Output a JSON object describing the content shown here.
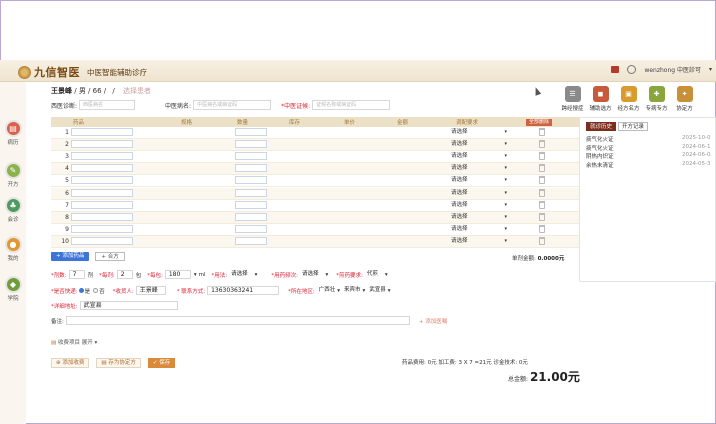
{
  "app": {
    "brand": "九信智医",
    "subtitle": "中医智能辅助诊疗",
    "user": "wenzhong 中医診可",
    "user_chevron": "▾"
  },
  "sidebar": [
    {
      "label": "病历",
      "icon": "medical-record-icon",
      "glyph": "▤",
      "color": "#d9604a"
    },
    {
      "label": "开方",
      "icon": "prescription-icon",
      "glyph": "✎",
      "color": "#8bb24b"
    },
    {
      "label": "会诊",
      "icon": "consultation-icon",
      "glyph": "♣",
      "color": "#4f9a5c"
    },
    {
      "label": "我的",
      "icon": "user-icon",
      "glyph": "●",
      "color": "#e3982f"
    },
    {
      "label": "学院",
      "icon": "academy-icon",
      "glyph": "◆",
      "color": "#6f9d3a"
    }
  ],
  "patient": {
    "name": "王景峰",
    "info": "/ 男 / 66 /",
    "slash": "/",
    "select_patient": "选择患者",
    "western_dx_label": "西医诊断:",
    "western_dx_placeholder": "西医病名",
    "tcm_disease_label": "中医病名:",
    "tcm_disease_placeholder": "中医病名或病证码",
    "tcm_syndrome_label": "*中医证候:",
    "tcm_syndrome_placeholder": "证候名称或病证码"
  },
  "table": {
    "headers": [
      "药品",
      "规格",
      "数量",
      "库存",
      "单价",
      "金额",
      "调配要求",
      "全部删除"
    ],
    "rows": [
      {
        "num": "1",
        "req": "请选择"
      },
      {
        "num": "2",
        "req": "请选择"
      },
      {
        "num": "3",
        "req": "请选择"
      },
      {
        "num": "4",
        "req": "请选择"
      },
      {
        "num": "5",
        "req": "请选择"
      },
      {
        "num": "6",
        "req": "请选择"
      },
      {
        "num": "7",
        "req": "请选择"
      },
      {
        "num": "8",
        "req": "请选择"
      },
      {
        "num": "9",
        "req": "请选择"
      },
      {
        "num": "10",
        "req": "请选择"
      }
    ]
  },
  "actions": {
    "add_drug": "+ 添加药品",
    "combine": "+ 合方",
    "dose_total_label": "单剂金额:",
    "dose_total_value": "0.0000元"
  },
  "form": {
    "doses_label": "*剂数:",
    "doses_value": "7",
    "doses_unit": "剂",
    "daily_label": "*每剂:",
    "daily_value": "2",
    "daily_unit": "包",
    "each_label": "*每包:",
    "each_value": "180",
    "each_unit": "ml",
    "usage_label": "*用法:",
    "usage_value": "请选择",
    "timing_label": "*用药频次:",
    "timing_value": "请选择",
    "decoct_label": "*煎药要求:",
    "decoct_value": "代煎",
    "express_label": "*是否快递:",
    "yes": "是",
    "no": "否",
    "receiver_label": "*收货人:",
    "receiver_value": "王景峰",
    "phone_label": "* 联系方式:",
    "phone_value": "13630363241",
    "region_label": "*所在地区:",
    "province": "广西壮",
    "city": "来宾市",
    "district": "武宣县",
    "address_label": "*详细地址:",
    "address_value": "武宣县",
    "remark_label": "备注:",
    "add_remark": "+ 添加医嘱"
  },
  "section": {
    "title": "收费项目",
    "toggle": "展开 ▾"
  },
  "footer": {
    "btn1": "添加收费",
    "btn2": "存为协定方",
    "btn3": "保存",
    "fee_text": "药品费用: 0元   加工费: 3 X 7 =21元   诊金技术: 0元",
    "total_label": "总金额:",
    "total_value": "21.00元"
  },
  "tools": [
    {
      "label": "跨经搜症",
      "color": "#8a8a8a",
      "glyph": "☰"
    },
    {
      "label": "辅助选方",
      "color": "#c65a3a",
      "glyph": "◼"
    },
    {
      "label": "经方名方",
      "color": "#d99a2e",
      "glyph": "▣"
    },
    {
      "label": "专病专方",
      "color": "#8aa63b",
      "glyph": "✚"
    },
    {
      "label": "协定方",
      "color": "#c9903a",
      "glyph": "✦"
    }
  ],
  "history": {
    "tab1": "就诊历史",
    "tab2": "开方记录",
    "items": [
      {
        "name": "痰气化火证",
        "date": "2025-10-0"
      },
      {
        "name": "痰气化火证",
        "date": "2024-06-1"
      },
      {
        "name": "阴热内炽证",
        "date": "2024-06-0"
      },
      {
        "name": "余热未清证",
        "date": "2024-05-3"
      }
    ]
  }
}
